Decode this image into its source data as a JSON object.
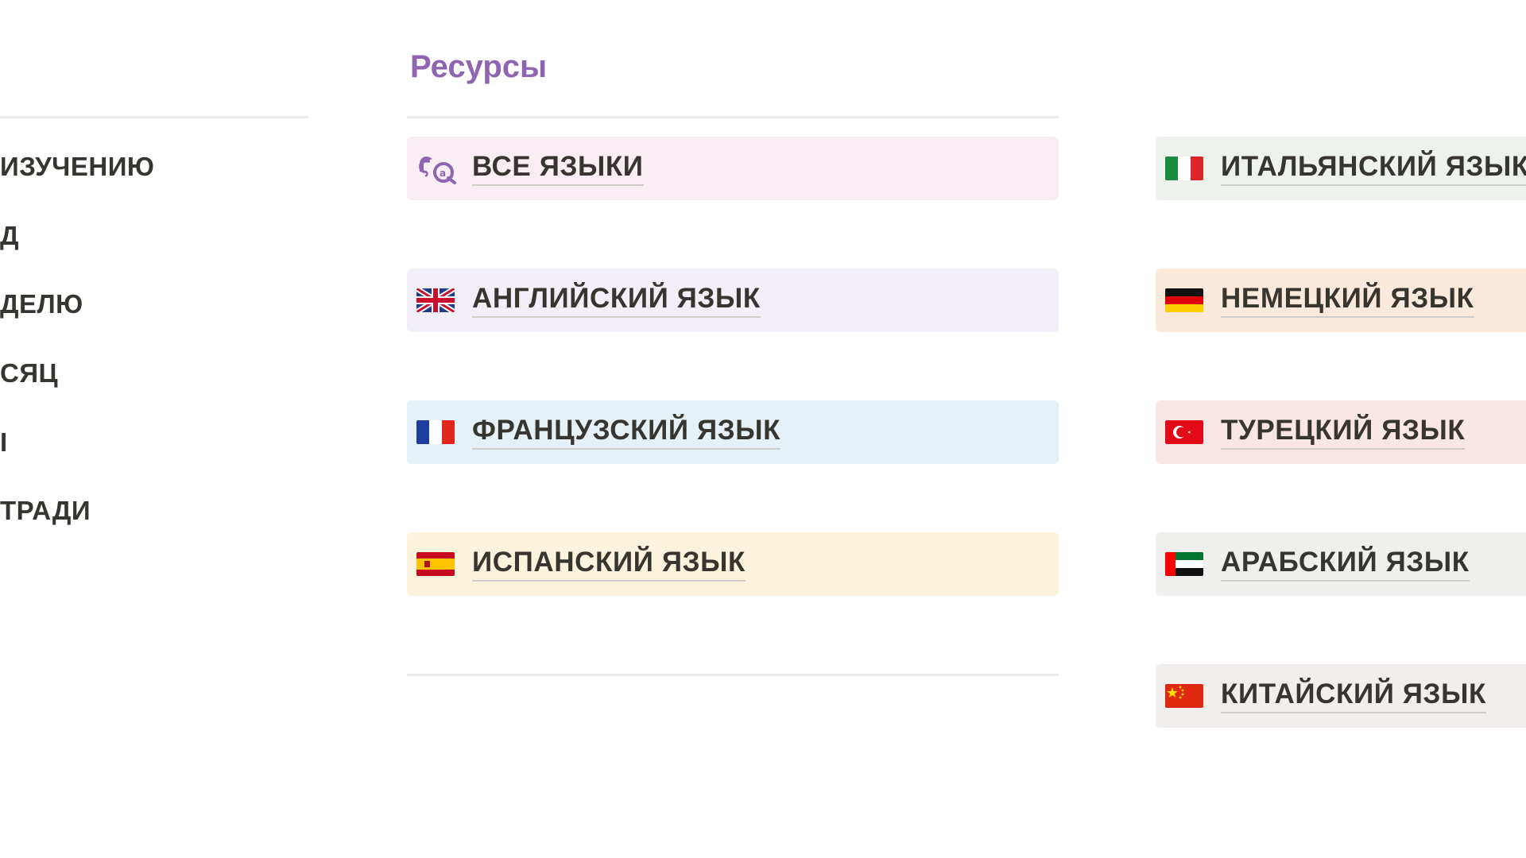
{
  "left_column": {
    "items": [
      {
        "label": "ИЗУЧЕНИЮ"
      },
      {
        "label": "Д"
      },
      {
        "label": "ДЕЛЮ"
      },
      {
        "label": "СЯЦ"
      },
      {
        "label": "І"
      },
      {
        "label": "ТРАДИ"
      }
    ]
  },
  "resources": {
    "title": "Ресурсы",
    "title_color": "#9065b0",
    "middle": [
      {
        "label": "ВСЕ ЯЗЫКИ",
        "icon": "translate-icon",
        "bg": "#f9eef4"
      },
      {
        "label": "АНГЛИЙСКИЙ ЯЗЫК",
        "icon": "uk-flag-icon",
        "bg": "#f3eff8"
      },
      {
        "label": "ФРАНЦУЗСКИЙ ЯЗЫК",
        "icon": "france-flag-icon",
        "bg": "#e6f0f7"
      },
      {
        "label": "ИСПАНСКИЙ ЯЗЫК",
        "icon": "spain-flag-icon",
        "bg": "#fbf3dc"
      }
    ],
    "right": [
      {
        "label": "ИТАЛЬЯНСКИЙ ЯЗЫК",
        "icon": "italy-flag-icon",
        "bg": "#edf2ec"
      },
      {
        "label": "НЕМЕЦКИЙ ЯЗЫК",
        "icon": "germany-flag-icon",
        "bg": "#fbeadc"
      },
      {
        "label": "ТУРЕЦКИЙ ЯЗЫК",
        "icon": "turkey-flag-icon",
        "bg": "#fbe6e6"
      },
      {
        "label": "АРАБСКИЙ ЯЗЫК",
        "icon": "uae-flag-icon",
        "bg": "#efefee"
      },
      {
        "label": "КИТАЙСКИЙ ЯЗЫК",
        "icon": "china-flag-icon",
        "bg": "#f3eeee"
      }
    ]
  }
}
